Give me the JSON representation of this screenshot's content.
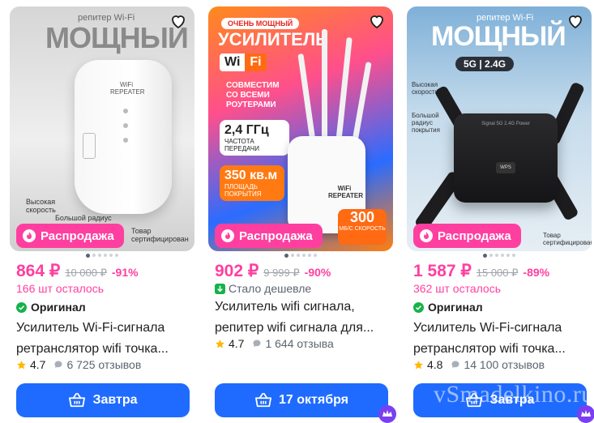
{
  "products": [
    {
      "image_text": {
        "top": "репитер Wi-Fi",
        "big": "МОЩНЫЙ",
        "device": "WiFi REPEATER",
        "speed": "Высокая скорость",
        "radius": "Большой радиус покрытия",
        "cert": "Товар сертифицирован"
      },
      "sale_label": "Распродажа",
      "price": "864 ₽",
      "old_price": "10 000 ₽",
      "discount": "-91%",
      "status": "166 шт осталось",
      "original": "Оригинал",
      "title_line1": "Усилитель Wi-Fi-сигнала",
      "title_line2": "ретранслятор wifi точка...",
      "rating": "4.7",
      "reviews": "6 725 отзывов",
      "button": "Завтра"
    },
    {
      "image_text": {
        "badge": "ОЧЕНЬ МОЩНЫЙ",
        "big": "УСИЛИТЕЛЬ",
        "wi": "Wi",
        "fi": "Fi",
        "compat": "СОВМЕСТИМ СО ВСЕМИ РОУТЕРАМИ",
        "freq": "2,4 ГГц",
        "freq_label": "ЧАСТОТА ПЕРЕДАЧИ",
        "area": "350 кв.м",
        "area_label": "ПЛОЩАДЬ ПОКРЫТИЯ",
        "speed": "300",
        "speed_label": "МБ/С СКОРОСТЬ",
        "device": "WiFi REPEATER"
      },
      "sale_label": "Распродажа",
      "price": "902 ₽",
      "old_price": "9 999 ₽",
      "discount": "-90%",
      "status": "Стало дешевле",
      "title_line1": "Усилитель wifi сигнала,",
      "title_line2": "репитер wifi сигнала для...",
      "rating": "4.7",
      "reviews": "1 644 отзыва",
      "button": "17 октября"
    },
    {
      "image_text": {
        "top": "репитер Wi-Fi",
        "big": "МОЩНЫЙ",
        "bands": "5G | 2.4G",
        "speed": "Высокая скорость",
        "radius": "Большой радиус покрытия",
        "cert": "Товар сертифицирован",
        "leds": "Signal 5G 2.4G Power",
        "wps": "WPS"
      },
      "sale_label": "Распродажа",
      "price": "1 587 ₽",
      "old_price": "15 000 ₽",
      "discount": "-89%",
      "status": "362 шт осталось",
      "original": "Оригинал",
      "title_line1": "Усилитель Wi-Fi-сигнала",
      "title_line2": "ретранслятор wifi точка...",
      "rating": "4.8",
      "reviews": "14 100 отзывов",
      "button": "Завтра"
    }
  ],
  "watermark": "vSmadelkino.ru",
  "colors": {
    "accent": "#ff3fa0",
    "button": "#1f6bff",
    "star": "#ffb800",
    "original_check": "#15b34a",
    "cheaper_arrow": "#15b34a"
  },
  "icons": [
    "heart-icon",
    "flame-icon",
    "check-icon",
    "arrow-down-icon",
    "star-icon",
    "chat-bubble-icon",
    "basket-icon",
    "crown-badge-icon"
  ]
}
